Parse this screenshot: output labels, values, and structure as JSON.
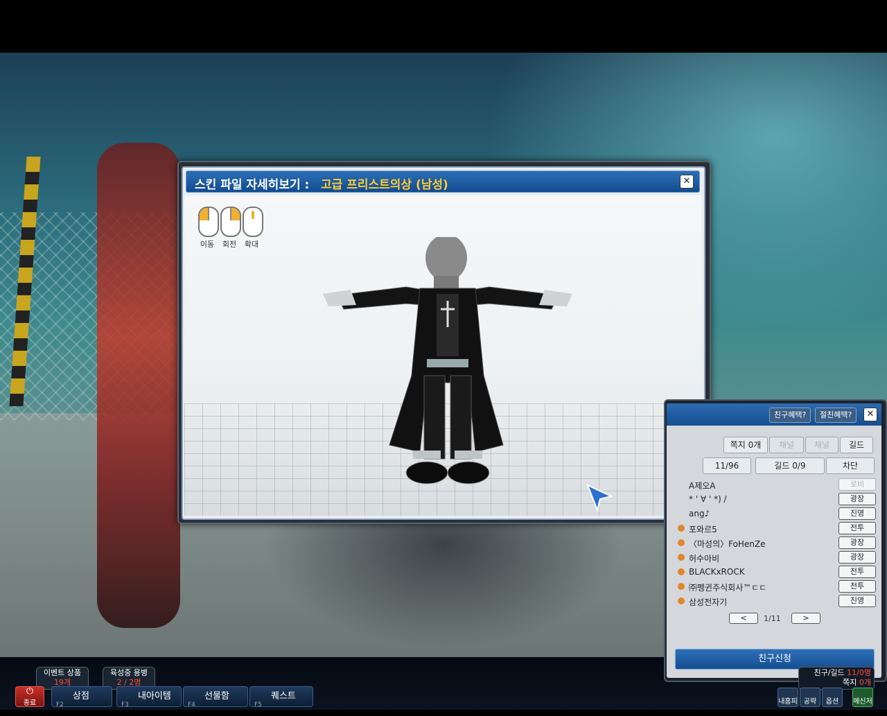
{
  "skin_window": {
    "title_prefix": "스킨 파일 자세히보기 :",
    "title_item": "고급 프리스트의상 (남성)",
    "close_label": "✕",
    "mouse_hints": [
      "이동",
      "회전",
      "확대"
    ]
  },
  "friend_panel": {
    "header_buttons": [
      "친구혜택?",
      "절친혜택?"
    ],
    "close_label": "✕",
    "tabs_row1": [
      "쪽지 0개",
      "채널",
      "채널",
      "길드"
    ],
    "tabs_row2": [
      "11/96",
      "길드 0/9",
      "차단"
    ],
    "friends": [
      {
        "name": "A제오A",
        "status": "로비",
        "status_dim": true
      },
      {
        "name": "* ' ∀ ' *) /",
        "status": "광장",
        "status_dim": false
      },
      {
        "name": "ang♪",
        "status": "진영",
        "status_dim": false
      },
      {
        "name": "포와르5",
        "status": "전투",
        "status_dim": false
      },
      {
        "name": "〈마성의〉FoHenZe",
        "status": "광장",
        "status_dim": false
      },
      {
        "name": "허수아비",
        "status": "광장",
        "status_dim": false
      },
      {
        "name": "BLACKxROCK",
        "status": "전투",
        "status_dim": false
      },
      {
        "name": "㈜펭귄주식회사™ㄷㄷ",
        "status": "전투",
        "status_dim": false
      },
      {
        "name": "삼성전자기",
        "status": "진영",
        "status_dim": false
      }
    ],
    "page_indicator": "1/11",
    "prev_label": "<",
    "next_label": ">",
    "request_button": "친구신청"
  },
  "bottom_bar": {
    "exit_label": "종료",
    "badges": [
      {
        "title": "이벤트 상품",
        "value": "19개"
      },
      {
        "title": "육성중 용병",
        "value": "2 / 2명"
      }
    ],
    "fkeys": [
      {
        "key": "F2",
        "label": "상점"
      },
      {
        "key": "F3",
        "label": "내아이템"
      },
      {
        "key": "F4",
        "label": "선물함"
      },
      {
        "key": "F5",
        "label": "퀘스트"
      }
    ],
    "right_buttons": [
      "내홈피",
      "공략",
      "옵션",
      "메신저"
    ],
    "friend_guild_status": {
      "line1_prefix": "친구/길드",
      "line1_value": "11/0명",
      "line2_prefix": "쪽지",
      "line2_value": "0개"
    }
  }
}
